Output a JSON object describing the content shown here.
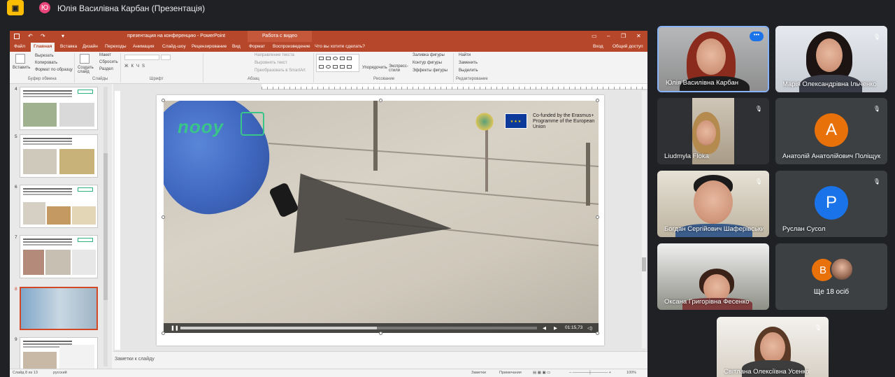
{
  "meet": {
    "presenter_initial": "Ю",
    "presenter_title": "Юлія Василівна Карбан (Презентація)"
  },
  "ppt": {
    "doc_title": "презентация на конференцию - PowerPoint",
    "context_tab": "Работа с видео",
    "tabs": [
      "Файл",
      "Главная",
      "Вставка",
      "Дизайн",
      "Переходы",
      "Анимация",
      "Слайд-шоу",
      "Рецензирование",
      "Вид",
      "Формат",
      "Воспроизведение"
    ],
    "active_tab": "Главная",
    "tell_me": "Что вы хотите сделать?",
    "signin": "Вход",
    "share": "Общий доступ",
    "ribbon": {
      "paste": "Вставить",
      "cut": "Вырезать",
      "copy": "Копировать",
      "format_painter": "Формат по образцу",
      "clipboard": "Буфер обмена",
      "new_slide": "Создать слайд",
      "layout": "Макет",
      "reset": "Сбросить",
      "section": "Раздел",
      "slides": "Слайды",
      "font": "Шрифт",
      "text_direction": "Направление текста",
      "align_text": "Выровнять текст",
      "smartart": "Преобразовать в SmartArt",
      "paragraph": "Абзац",
      "arrange": "Упорядочить",
      "quick_styles": "Экспресс-стили",
      "drawing": "Рисование",
      "shape_fill": "Заливка фигуры",
      "shape_outline": "Контур фигуры",
      "shape_effects": "Эффекты фигуры",
      "find": "Найти",
      "replace": "Заменить",
      "select": "Выделить",
      "editing": "Редактирование"
    },
    "slides": [
      {
        "num": "4"
      },
      {
        "num": "5"
      },
      {
        "num": "6"
      },
      {
        "num": "7"
      },
      {
        "num": "8",
        "selected": true
      },
      {
        "num": "9"
      }
    ],
    "video": {
      "logo_text": "nooy",
      "eu_text": "Co-funded by the Erasmus+ Programme of the European Union",
      "time": "01:15,73",
      "progress": 0.55
    },
    "notes_placeholder": "Заметки к слайду",
    "status": {
      "slide_info": "Слайд 8 из 13",
      "language": "русский",
      "notes": "Заметки",
      "comments": "Примечания",
      "zoom": "100%"
    }
  },
  "participants": [
    {
      "name": "Юлія Василівна Карбан",
      "active": true,
      "type": "camera"
    },
    {
      "name": "Марія Олександрівна Ільченко",
      "muted": true,
      "type": "camera"
    },
    {
      "name": "Liudmyla Floka",
      "muted": true,
      "type": "camera"
    },
    {
      "name": "Анатолій Анатолійович Поліщук",
      "muted": true,
      "type": "avatar",
      "initial": "А",
      "color": "#e8710a"
    },
    {
      "name": "Богдан Сергійович Шаферівський",
      "muted": true,
      "type": "camera"
    },
    {
      "name": "Руслан Сусол",
      "muted": true,
      "type": "avatar",
      "initial": "Р",
      "color": "#1a73e8"
    },
    {
      "name": "Оксана Григорівна Фесенко",
      "type": "camera"
    },
    {
      "name": "Ще 18 осіб",
      "type": "more",
      "initial": "В"
    },
    {
      "name": "Світлана Олексіївна Усенко",
      "muted": true,
      "type": "camera"
    }
  ],
  "icons": {
    "present": "present-to-all-icon",
    "mic_off": "mic-off-icon",
    "more": "more-options-icon"
  }
}
